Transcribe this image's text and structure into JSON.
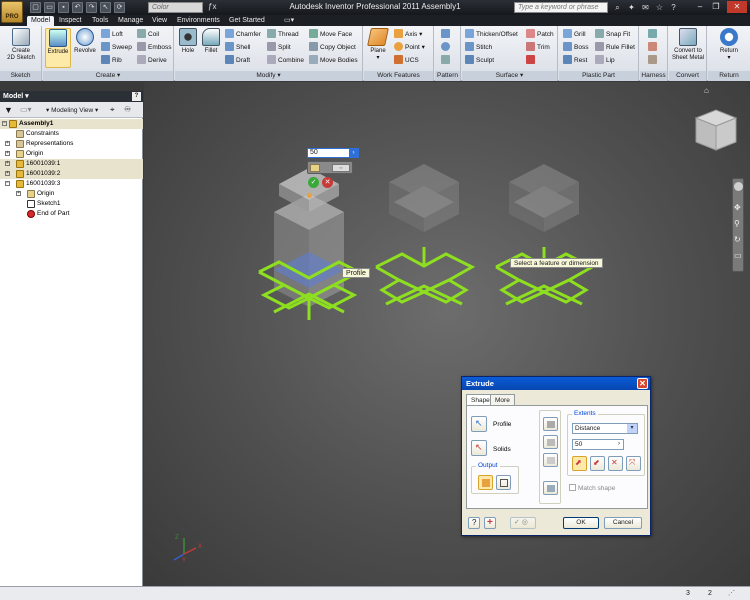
{
  "app": {
    "title": "Autodesk Inventor Professional 2011    Assembly1",
    "logo": "PRO",
    "search_placeholder": "Type a keyword or phrase",
    "color_placeholder": "Color"
  },
  "ribbon_tabs": [
    "Model",
    "Inspect",
    "Tools",
    "Manage",
    "View",
    "Environments",
    "Get Started"
  ],
  "active_tab": "Model",
  "panels": {
    "sketch": {
      "title": "Sketch",
      "create_label": "Create\n2D Sketch"
    },
    "create": {
      "title": "Create",
      "extrude": "Extrude",
      "revolve": "Revolve",
      "loft": "Loft",
      "sweep": "Sweep",
      "rib": "Rib",
      "coil": "Coil",
      "emboss": "Emboss",
      "derive": "Derive"
    },
    "modify": {
      "title": "Modify",
      "hole": "Hole",
      "fillet": "Fillet",
      "chamfer": "Chamfer",
      "shell": "Shell",
      "draft": "Draft",
      "thread": "Thread",
      "split": "Split",
      "combine": "Combine",
      "move_face": "Move Face",
      "copy_object": "Copy Object",
      "move_bodies": "Move Bodies"
    },
    "work": {
      "title": "Work Features",
      "plane": "Plane",
      "axis": "Axis",
      "point": "Point",
      "ucs": "UCS"
    },
    "pattern": {
      "title": "Pattern"
    },
    "surface": {
      "title": "Surface",
      "thicken": "Thicken/Offset",
      "stitch": "Stitch",
      "sculpt": "Sculpt",
      "patch": "Patch",
      "trim": "Trim"
    },
    "plastic": {
      "title": "Plastic Part",
      "grill": "Grill",
      "boss": "Boss",
      "rest": "Rest",
      "snap_fit": "Snap Fit",
      "rule_fillet": "Rule Fillet",
      "lip": "Lip"
    },
    "harness": {
      "title": "Harness"
    },
    "convert": {
      "title": "Convert",
      "label": "Convert to\nSheet Metal"
    },
    "return": {
      "title": "Return",
      "label": "Return"
    }
  },
  "browser": {
    "title": "Model",
    "view_label": "Modeling View",
    "items": [
      {
        "label": "Assembly1",
        "depth": 0
      },
      {
        "label": "Constraints",
        "depth": 1
      },
      {
        "label": "Representations",
        "depth": 1
      },
      {
        "label": "Origin",
        "depth": 1
      },
      {
        "label": "16001039:1",
        "depth": 1
      },
      {
        "label": "16001039:2",
        "depth": 1
      },
      {
        "label": "16001039:3",
        "depth": 1
      },
      {
        "label": "Origin",
        "depth": 2
      },
      {
        "label": "Sketch1",
        "depth": 2
      },
      {
        "label": "End of Part",
        "depth": 2
      }
    ]
  },
  "viewport": {
    "dimension_value": "50",
    "profile_tooltip": "Profile",
    "select_tooltip": "Select a feature or dimension",
    "axis_labels": [
      "Z",
      "X",
      "Y"
    ]
  },
  "dialog": {
    "title": "Extrude",
    "tabs": [
      "Shape",
      "More"
    ],
    "profile_label": "Profile",
    "solids_label": "Solids",
    "output_label": "Output",
    "extents_label": "Extents",
    "extents_type": "Distance",
    "distance_value": "50",
    "match_shape": "Match shape",
    "ok": "OK",
    "cancel": "Cancel"
  },
  "status": {
    "count_a": "3",
    "count_b": "2"
  },
  "colors": {
    "accent": "#2e6fd8",
    "profile_green": "#8ddf1f",
    "dialog_title": "#0a5cd6"
  }
}
